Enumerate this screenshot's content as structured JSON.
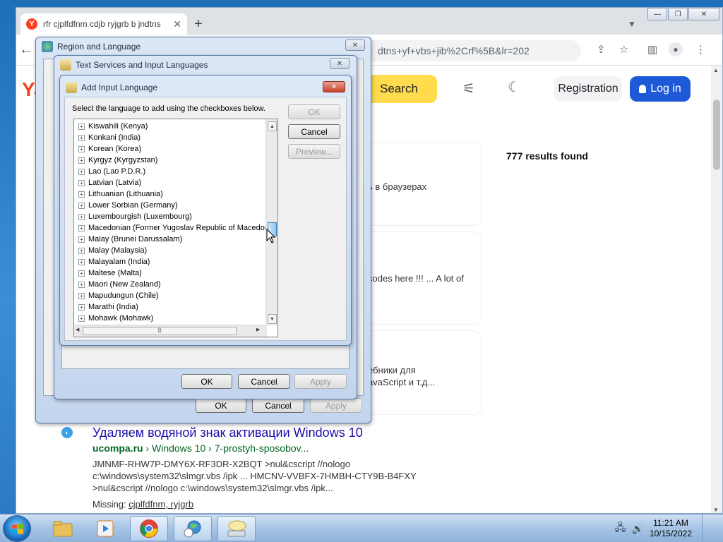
{
  "browser": {
    "tab_title": "rfr cjplfdfnm cdjb ryjgrb b jndtns",
    "tab_close": "✕",
    "new_tab": "+",
    "url_visible": "dtns+yf+vbs+jib%2Crf%5B&lr=202",
    "window_controls": [
      "—",
      "❐",
      "✕"
    ]
  },
  "yandex": {
    "logo": "Ya",
    "search_button": "Search",
    "registration_button": "Registration",
    "login_button": "Log in",
    "results_count": "777 results found",
    "fragments": [
      "ь в браузерах",
      "codes here !!! ... A lot of",
      "ебники для",
      "avaScript и т.д..."
    ]
  },
  "result4": {
    "title": "Удаляем водяной знак активации Windows 10",
    "site": "ucompa.ru",
    "breadcrumb": " › Windows 10 › 7-prostyh-sposobov...",
    "snippet": [
      "JMNMF-RHW7P-DMY6X-RF3DR-X2BQT >nul&cscript //nologo",
      "c:\\windows\\system32\\slmgr.vbs /ipk ... HMCNV-VVBFX-7HMBH-CTY9B-B4FXY",
      ">nul&cscript //nologo c:\\windows\\system32\\slmgr.vbs /ipk..."
    ],
    "missing_label": "Missing: ",
    "missing_terms": "cjplfdfnm, ryjgrb"
  },
  "region_dialog": {
    "title": "Region and Language",
    "ok": "OK",
    "cancel": "Cancel",
    "apply": "Apply"
  },
  "text_services_dialog": {
    "title": "Text Services and Input Languages",
    "ok": "OK",
    "cancel": "Cancel",
    "apply": "Apply"
  },
  "add_input_dialog": {
    "title": "Add Input Language",
    "instruction": "Select the language to add using the checkboxes below.",
    "ok": "OK",
    "cancel": "Cancel",
    "preview": "Preview...",
    "languages": [
      "Kiswahili (Kenya)",
      "Konkani (India)",
      "Korean (Korea)",
      "Kyrgyz (Kyrgyzstan)",
      "Lao (Lao P.D.R.)",
      "Latvian (Latvia)",
      "Lithuanian (Lithuania)",
      "Lower Sorbian (Germany)",
      "Luxembourgish (Luxembourg)",
      "Macedonian (Former Yugoslav Republic of Macedonia)",
      "Malay (Brunei Darussalam)",
      "Malay (Malaysia)",
      "Malayalam (India)",
      "Maltese (Malta)",
      "Maori (New Zealand)",
      "Mapudungun (Chile)",
      "Marathi (India)",
      "Mohawk (Mohawk)"
    ]
  },
  "taskbar": {
    "time": "11:21 AM",
    "date": "10/15/2022"
  },
  "colors": {
    "yandex_red": "#fc3f1d",
    "search_yellow": "#ffdb4d",
    "login_blue": "#1e5ad8",
    "link_blue": "#1a0dab",
    "url_green": "#006621"
  }
}
